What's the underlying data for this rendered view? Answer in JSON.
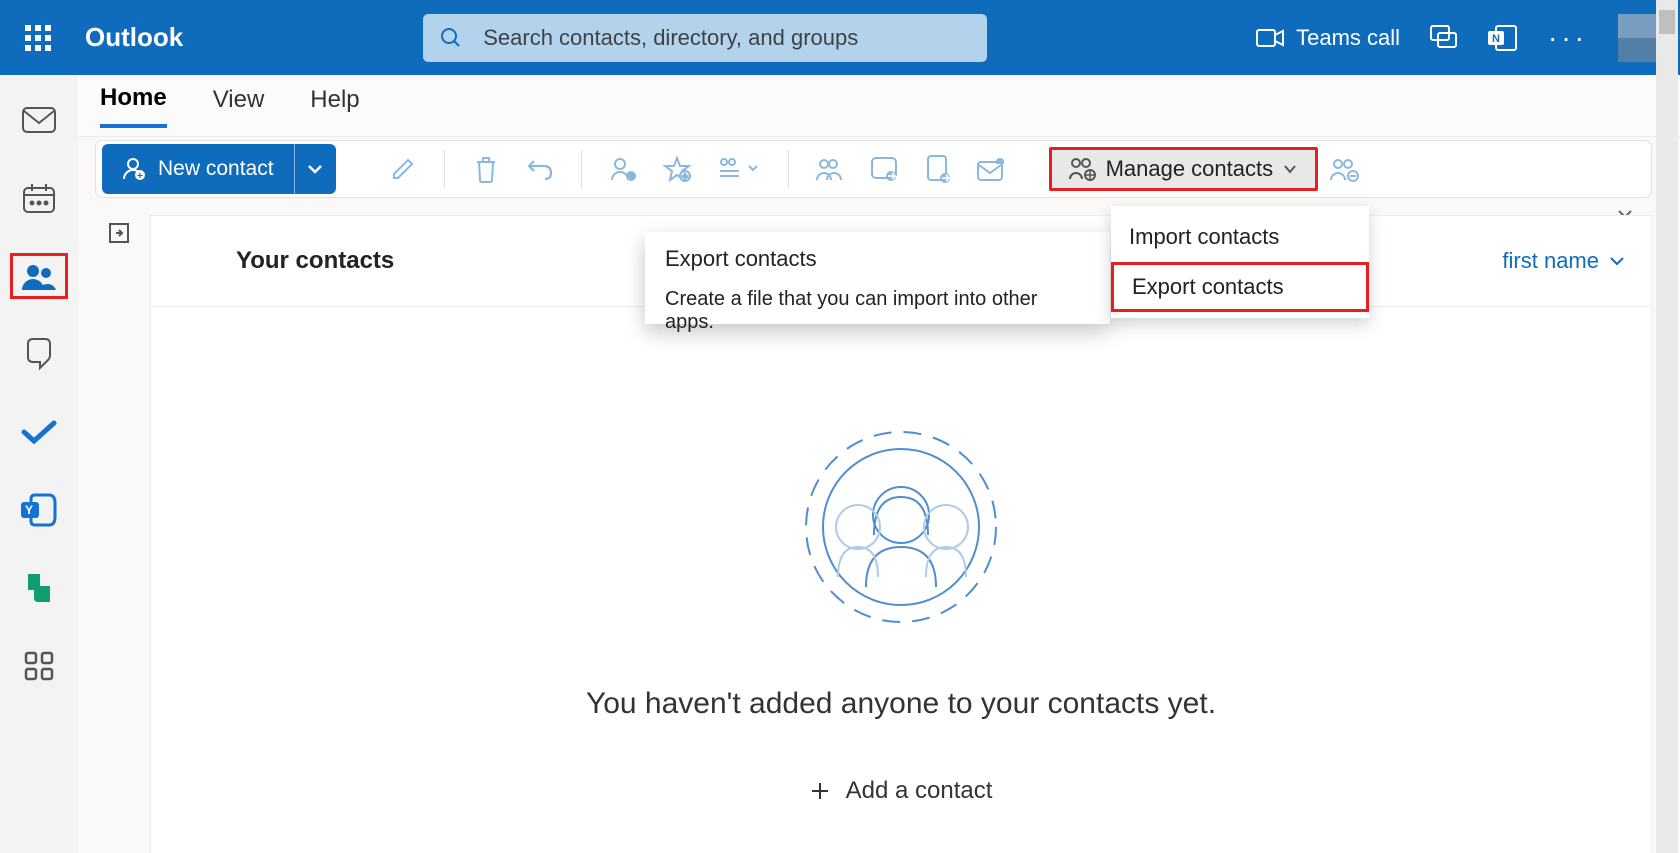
{
  "header": {
    "app_name": "Outlook",
    "search_placeholder": "Search contacts, directory, and groups",
    "teams_call_label": "Teams call"
  },
  "tabs": {
    "home": "Home",
    "view": "View",
    "help": "Help"
  },
  "toolbar": {
    "new_contact_label": "New contact",
    "manage_contacts_label": "Manage contacts"
  },
  "heading": {
    "title": "Your contacts",
    "sort_label": "first name"
  },
  "empty": {
    "text": "You haven't added anyone to your contacts yet.",
    "add_label": "Add a contact"
  },
  "dropdown": {
    "import_label": "Import contacts",
    "export_label": "Export contacts"
  },
  "tooltip": {
    "title": "Export contacts",
    "desc": "Create a file that you can import into other apps."
  }
}
